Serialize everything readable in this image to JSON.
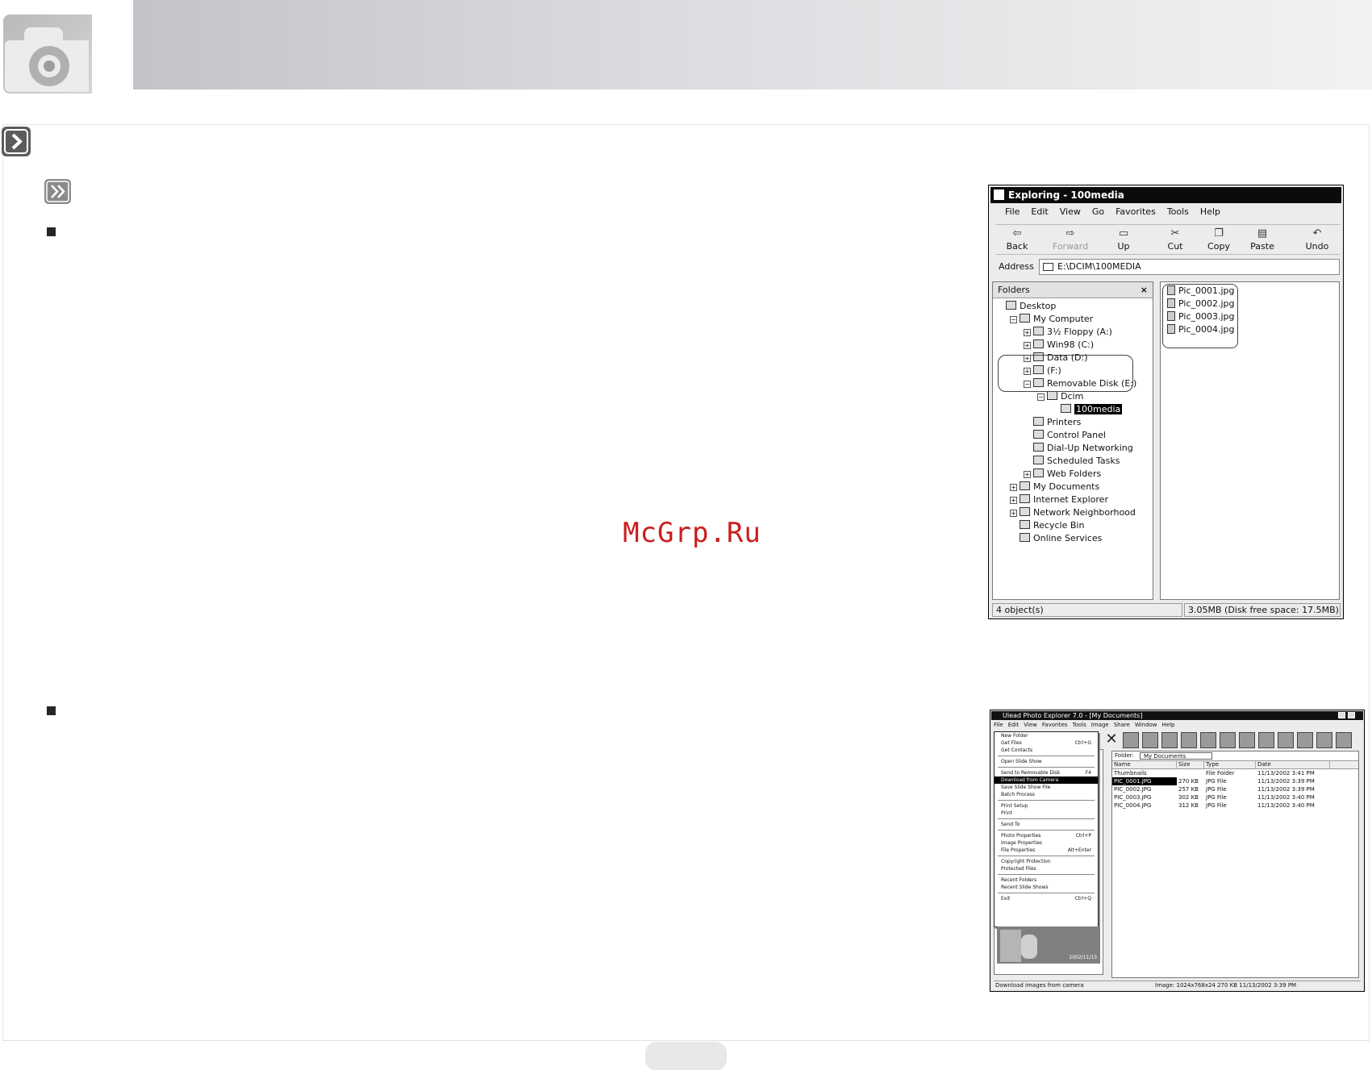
{
  "watermark": "McGrp.Ru",
  "explorer": {
    "title": "Exploring - 100media",
    "menu": [
      "File",
      "Edit",
      "View",
      "Go",
      "Favorites",
      "Tools",
      "Help"
    ],
    "toolbar": [
      {
        "label": "Back",
        "icon": "back-arrow-icon",
        "enabled": true
      },
      {
        "label": "Forward",
        "icon": "forward-arrow-icon",
        "enabled": false
      },
      {
        "label": "Up",
        "icon": "up-folder-icon",
        "enabled": true
      },
      {
        "label": "Cut",
        "icon": "scissors-icon",
        "enabled": true
      },
      {
        "label": "Copy",
        "icon": "copy-icon",
        "enabled": true
      },
      {
        "label": "Paste",
        "icon": "paste-icon",
        "enabled": true
      },
      {
        "label": "Undo",
        "icon": "undo-icon",
        "enabled": true
      }
    ],
    "address_label": "Address",
    "address_value": "E:\\DCIM\\100MEDIA",
    "folders_label": "Folders",
    "folders_close": "×",
    "tree": [
      {
        "label": "Desktop",
        "depth": 0,
        "toggle": ""
      },
      {
        "label": "My Computer",
        "depth": 1,
        "toggle": "−"
      },
      {
        "label": "3½ Floppy (A:)",
        "depth": 2,
        "toggle": "+"
      },
      {
        "label": "Win98 (C:)",
        "depth": 2,
        "toggle": "+"
      },
      {
        "label": "Data (D:)",
        "depth": 2,
        "toggle": "+"
      },
      {
        "label": "(F:)",
        "depth": 2,
        "toggle": "+"
      },
      {
        "label": "Removable Disk (E:)",
        "depth": 2,
        "toggle": "−"
      },
      {
        "label": "Dcim",
        "depth": 3,
        "toggle": "−"
      },
      {
        "label": "100media",
        "depth": 4,
        "toggle": "",
        "selected": true
      },
      {
        "label": "Printers",
        "depth": 2,
        "toggle": ""
      },
      {
        "label": "Control Panel",
        "depth": 2,
        "toggle": ""
      },
      {
        "label": "Dial-Up Networking",
        "depth": 2,
        "toggle": ""
      },
      {
        "label": "Scheduled Tasks",
        "depth": 2,
        "toggle": ""
      },
      {
        "label": "Web Folders",
        "depth": 2,
        "toggle": "+"
      },
      {
        "label": "My Documents",
        "depth": 1,
        "toggle": "+"
      },
      {
        "label": "Internet Explorer",
        "depth": 1,
        "toggle": "+"
      },
      {
        "label": "Network Neighborhood",
        "depth": 1,
        "toggle": "+"
      },
      {
        "label": "Recycle Bin",
        "depth": 1,
        "toggle": ""
      },
      {
        "label": "Online Services",
        "depth": 1,
        "toggle": ""
      }
    ],
    "files": [
      "Pic_0001.jpg",
      "Pic_0002.jpg",
      "Pic_0003.jpg",
      "Pic_0004.jpg"
    ],
    "status_left": "4 object(s)",
    "status_right": "3.05MB (Disk free space: 17.5MB)"
  },
  "media": {
    "title": "Ulead Photo Explorer 7.0 - [My Documents]",
    "menu": [
      "File",
      "Edit",
      "View",
      "Favorites",
      "Tools",
      "Image",
      "Share",
      "Window",
      "Help"
    ],
    "file_menu": [
      {
        "label": "New Folder",
        "shortcut": "",
        "hl": false
      },
      {
        "label": "Get Files",
        "shortcut": "Ctrl+G",
        "hl": false
      },
      {
        "label": "Get Contacts",
        "shortcut": "",
        "hl": false
      },
      {
        "sep": true
      },
      {
        "label": "Open Slide Show",
        "shortcut": "",
        "hl": false
      },
      {
        "sep": true
      },
      {
        "label": "Send to Removable Disk",
        "shortcut": "F4",
        "hl": false
      },
      {
        "label": "Download from Camera",
        "shortcut": "",
        "hl": true
      },
      {
        "label": "Save Slide Show File",
        "shortcut": "",
        "hl": false
      },
      {
        "label": "Batch Process",
        "shortcut": "",
        "hl": false
      },
      {
        "sep": true
      },
      {
        "label": "Print Setup",
        "shortcut": "",
        "hl": false
      },
      {
        "label": "Print",
        "shortcut": "",
        "hl": false
      },
      {
        "sep": true
      },
      {
        "label": "Send To",
        "shortcut": "",
        "hl": false
      },
      {
        "sep": true
      },
      {
        "label": "Photo Properties",
        "shortcut": "Ctrl+P",
        "hl": false
      },
      {
        "label": "Image Properties",
        "shortcut": "",
        "hl": false
      },
      {
        "label": "File Properties",
        "shortcut": "Alt+Enter",
        "hl": false
      },
      {
        "sep": true
      },
      {
        "label": "Copyright Protection",
        "shortcut": "",
        "hl": false
      },
      {
        "label": "Protected Files",
        "shortcut": "",
        "hl": false
      },
      {
        "sep": true
      },
      {
        "label": "Recent Folders",
        "shortcut": "",
        "hl": false
      },
      {
        "label": "Recent Slide Shows",
        "shortcut": "",
        "hl": false
      },
      {
        "sep": true
      },
      {
        "label": "Exit",
        "shortcut": "Ctrl+Q",
        "hl": false
      }
    ],
    "address_label": "Folder:",
    "address_value": "My Documents",
    "columns": [
      "Name",
      "Size",
      "Type",
      "Date"
    ],
    "rows": [
      {
        "name": "Thumbnails",
        "size": "",
        "type": "File Folder",
        "date": "11/13/2002 3:41 PM",
        "sel": false
      },
      {
        "name": "PIC_0001.JPG",
        "size": "270 KB",
        "type": "JPG File",
        "date": "11/13/2002 3:39 PM",
        "sel": true
      },
      {
        "name": "PIC_0002.JPG",
        "size": "257 KB",
        "type": "JPG File",
        "date": "11/13/2002 3:39 PM",
        "sel": false
      },
      {
        "name": "PIC_0003.JPG",
        "size": "302 KB",
        "type": "JPG File",
        "date": "11/13/2002 3:40 PM",
        "sel": false
      },
      {
        "name": "PIC_0004.JPG",
        "size": "312 KB",
        "type": "JPG File",
        "date": "11/13/2002 3:40 PM",
        "sel": false
      }
    ],
    "preview_date": "2002/11/13",
    "status_left": "Download images from camera",
    "status_right": "Image: 1024x768x24  270 KB  11/13/2002 3:39 PM"
  }
}
